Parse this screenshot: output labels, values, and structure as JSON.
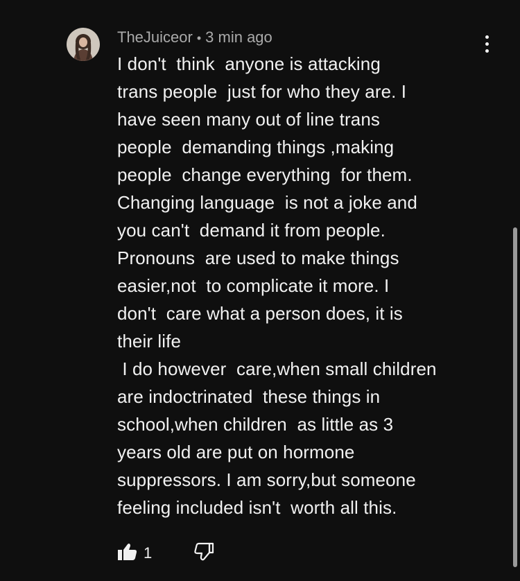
{
  "comment": {
    "author": "TheJuiceor",
    "separator": "•",
    "time": "3 min ago",
    "text": "I don't  think  anyone is attacking\ntrans people  just for who they are. I\nhave seen many out of line trans\npeople  demanding things ,making\npeople  change everything  for them.\nChanging language  is not a joke and\nyou can't  demand it from people.\nPronouns  are used to make things\neasier,not  to complicate it more. I\ndon't  care what a person does, it is\ntheir life\n I do however  care,when small children\nare indoctrinated  these things in\nschool,when children  as little as 3\nyears old are put on hormone\nsuppressors. I am sorry,but someone\nfeeling included isn't  worth all this.",
    "like_count": "1"
  },
  "icons": {
    "menu": "kebab-menu-icon",
    "like": "thumbs-up-icon",
    "dislike": "thumbs-down-icon"
  },
  "colors": {
    "background": "#0f0f0f",
    "text": "#f1f1f1",
    "meta": "#aaaaaa"
  }
}
